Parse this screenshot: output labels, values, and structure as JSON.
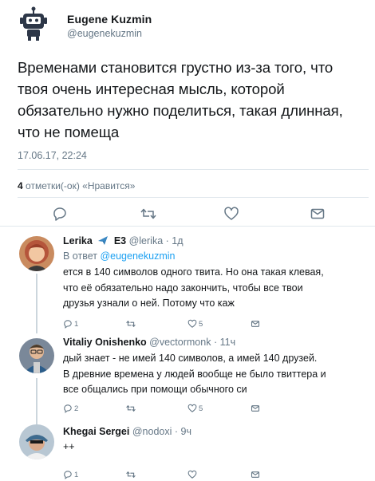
{
  "tweet": {
    "author_name": "Eugene Kuzmin",
    "author_handle": "@eugenekuzmin",
    "text_lines": [
      "Временами становится грустно из-за того, что",
      "твоя очень интересная мысль, которой",
      "обязательно нужно поделиться, такая длинная,",
      "что не помеща"
    ],
    "timestamp": "17.06.17, 22:24",
    "likes_count": "4",
    "likes_label": "отметки(-ок) «Нравится»"
  },
  "replies": [
    {
      "name": "Lerika",
      "extra": "E3",
      "handle": "@lerika",
      "time": "1д",
      "reply_to_label": "В ответ",
      "reply_to_handle": "@eugenekuzmin",
      "lines": [
        "ется в 140 символов одного твита. Но она такая клевая,",
        "что её обязательно надо закончить, чтобы все твои",
        "друзья узнали о ней. Потому что каж"
      ],
      "reply_count": "1",
      "retweet_count": "",
      "like_count": "5"
    },
    {
      "name": "Vitaliy Onishenko",
      "handle": "@vectormonk",
      "time": "11ч",
      "lines": [
        "дый знает - не имей 140 символов, а имей 140 друзей.",
        "В древние времена у людей вообще не было твиттера и",
        "все общались при помощи обычного си"
      ],
      "reply_count": "2",
      "retweet_count": "",
      "like_count": "5"
    },
    {
      "name": "Khegai Sergei",
      "handle": "@nodoxi",
      "time": "9ч",
      "lines": [
        "++"
      ],
      "reply_count": "1",
      "retweet_count": "",
      "like_count": ""
    }
  ],
  "colors": {
    "text": "#14171a",
    "secondary": "#657786",
    "link": "#1da1f2",
    "divider": "#e1e8ed",
    "thread": "#ccd6dd"
  },
  "icons": [
    "robot-avatar-icon",
    "reply-icon",
    "retweet-icon",
    "heart-icon",
    "dm-icon",
    "plane-emoji-icon"
  ]
}
